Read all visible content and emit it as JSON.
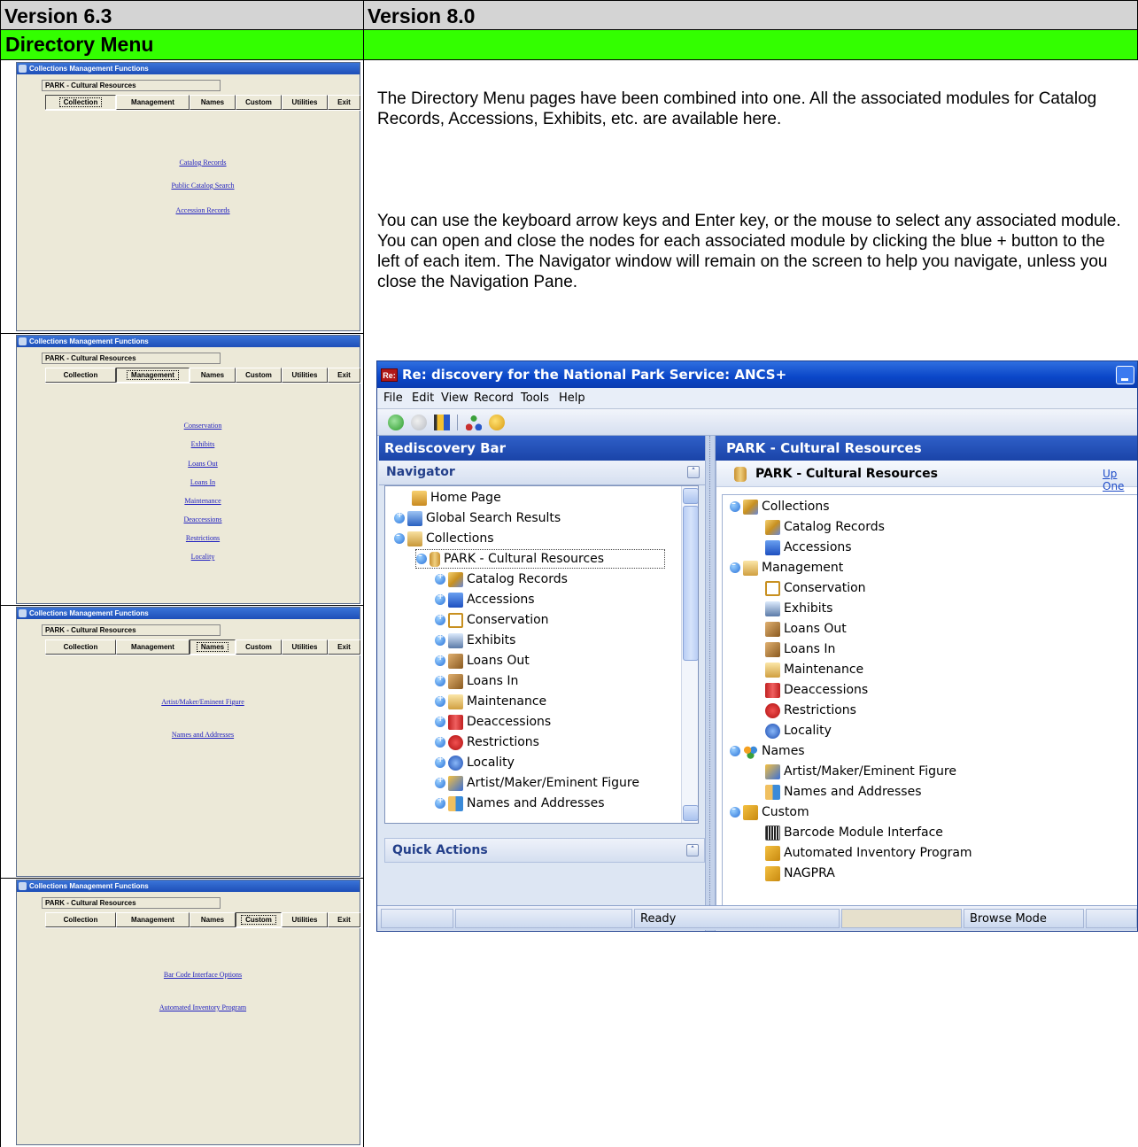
{
  "header": {
    "col1": "Version 6.3",
    "col2": "Version 8.0"
  },
  "section": {
    "title": "Directory Menu"
  },
  "old_windows": {
    "title": "Collections Management Functions",
    "park": "PARK - Cultural Resources",
    "tabs": [
      "Collection",
      "Management",
      "Names",
      "Custom",
      "Utilities",
      "Exit"
    ],
    "panel1": {
      "selected": "Collection",
      "links": [
        "Catalog Records",
        "Public Catalog Search",
        "Accession Records"
      ]
    },
    "panel2": {
      "selected": "Management",
      "links": [
        "Conservation",
        "Exhibits",
        "Loans Out",
        "Loans In",
        "Maintenance",
        "Deaccessions",
        "Restrictions",
        "Locality"
      ]
    },
    "panel3": {
      "selected": "Names",
      "links": [
        "Artist/Maker/Eminent Figure",
        "Names and Addresses"
      ]
    },
    "panel4": {
      "selected": "Custom",
      "links": [
        "Bar Code Interface Options",
        "Automated Inventory Program"
      ]
    }
  },
  "description": {
    "para1": "The Directory Menu pages have been combined into one.  All the associated modules for Catalog Records, Accessions, Exhibits, etc. are available here.",
    "para2": "You can use the keyboard arrow keys and Enter key, or the mouse to select any associated module.  You can open and close the nodes for each associated module by clicking the blue + button to the left of each item.  The Navigator window will remain on the screen to help you navigate, unless you close the Navigation Pane."
  },
  "app": {
    "title": "Re: discovery for the National Park Service: ANCS+",
    "icon_text": "Re:",
    "menu": [
      "File",
      "Edit",
      "View",
      "Record",
      "Tools",
      "Help"
    ],
    "left_header": "Rediscovery Bar",
    "navigator": "Navigator",
    "quick_actions": "Quick Actions",
    "right_header": "PARK - Cultural Resources",
    "right_title_bold": "PARK",
    "right_title_rest": " - Cultural Resources",
    "up_one": "Up One",
    "nav_tree": [
      "Home Page",
      "Global Search Results",
      "Collections",
      "PARK - Cultural Resources",
      "Catalog Records",
      "Accessions",
      "Conservation",
      "Exhibits",
      "Loans Out",
      "Loans In",
      "Maintenance",
      "Deaccessions",
      "Restrictions",
      "Locality",
      "Artist/Maker/Eminent Figure",
      "Names and Addresses"
    ],
    "right_tree": [
      "Collections",
      "Catalog Records",
      "Accessions",
      "Management",
      "Conservation",
      "Exhibits",
      "Loans Out",
      "Loans In",
      "Maintenance",
      "Deaccessions",
      "Restrictions",
      "Locality",
      "Names",
      "Artist/Maker/Eminent Figure",
      "Names and Addresses",
      "Custom",
      "Barcode Module Interface",
      "Automated Inventory Program",
      "NAGPRA"
    ],
    "status": {
      "ready": "Ready",
      "mode": "Browse Mode"
    },
    "colors": {
      "title_blue": "#0a46c8",
      "pane_blue": "#1a44a8",
      "accent_green": "#33ff00"
    }
  }
}
